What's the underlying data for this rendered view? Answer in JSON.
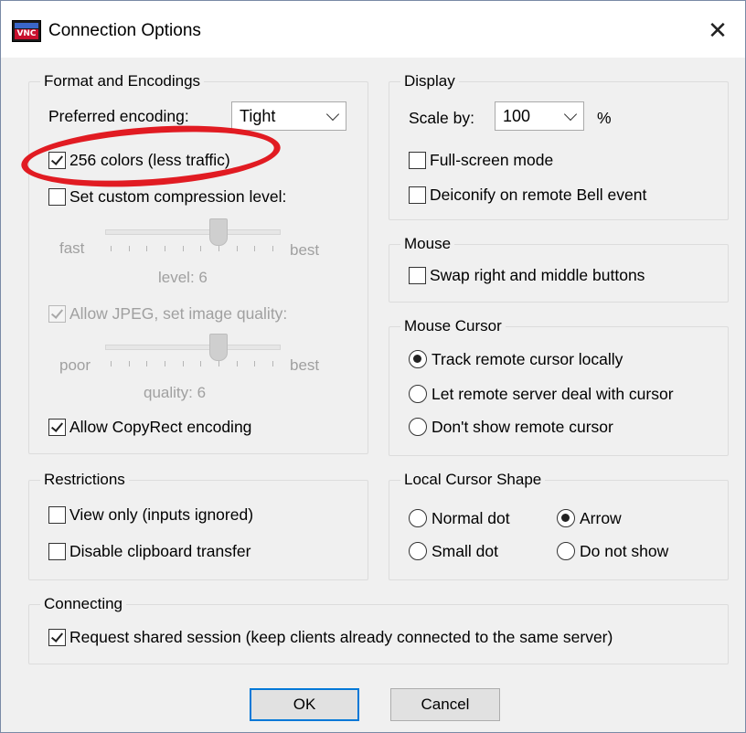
{
  "window": {
    "title": "Connection Options",
    "icon_text": "VNC",
    "close_glyph": "✕"
  },
  "format": {
    "label": "Format and Encodings",
    "preferred_encoding_label": "Preferred encoding:",
    "preferred_encoding_value": "Tight",
    "colors_256_label": "256 colors (less traffic)",
    "colors_256_checked": true,
    "custom_compression_label": "Set custom compression level:",
    "custom_compression_checked": false,
    "compression_slider": {
      "min_label": "fast",
      "max_label": "best",
      "level_text": "level: 6",
      "level": 6,
      "max": 9
    },
    "jpeg_label": "Allow JPEG, set image quality:",
    "jpeg_checked": true,
    "quality_slider": {
      "min_label": "poor",
      "max_label": "best",
      "quality_text": "quality: 6",
      "level": 6,
      "max": 9
    },
    "copyrect_label": "Allow CopyRect encoding",
    "copyrect_checked": true
  },
  "restrictions": {
    "label": "Restrictions",
    "view_only_label": "View only (inputs ignored)",
    "disable_clipboard_label": "Disable clipboard transfer"
  },
  "display": {
    "label": "Display",
    "scale_label": "Scale by:",
    "scale_value": "100",
    "scale_unit": "%",
    "fullscreen_label": "Full-screen mode",
    "deiconify_label": "Deiconify on remote Bell event"
  },
  "mouse": {
    "label": "Mouse",
    "swap_label": "Swap right and middle buttons"
  },
  "mouse_cursor": {
    "label": "Mouse Cursor",
    "options": [
      "Track remote cursor locally",
      "Let remote server deal with cursor",
      "Don't show remote cursor"
    ],
    "selected": "Track remote cursor locally"
  },
  "local_cursor": {
    "label": "Local Cursor Shape",
    "options": [
      "Normal dot",
      "Arrow",
      "Small dot",
      "Do not show"
    ],
    "selected": "Arrow"
  },
  "connecting": {
    "label": "Connecting",
    "shared_label": "Request shared session (keep clients already connected to the same server)",
    "shared_checked": true
  },
  "buttons": {
    "ok": "OK",
    "cancel": "Cancel"
  },
  "colors": {
    "annotation": "#e11b22",
    "default_button_border": "#0078d7",
    "dialog_bg": "#f0f0f0"
  }
}
